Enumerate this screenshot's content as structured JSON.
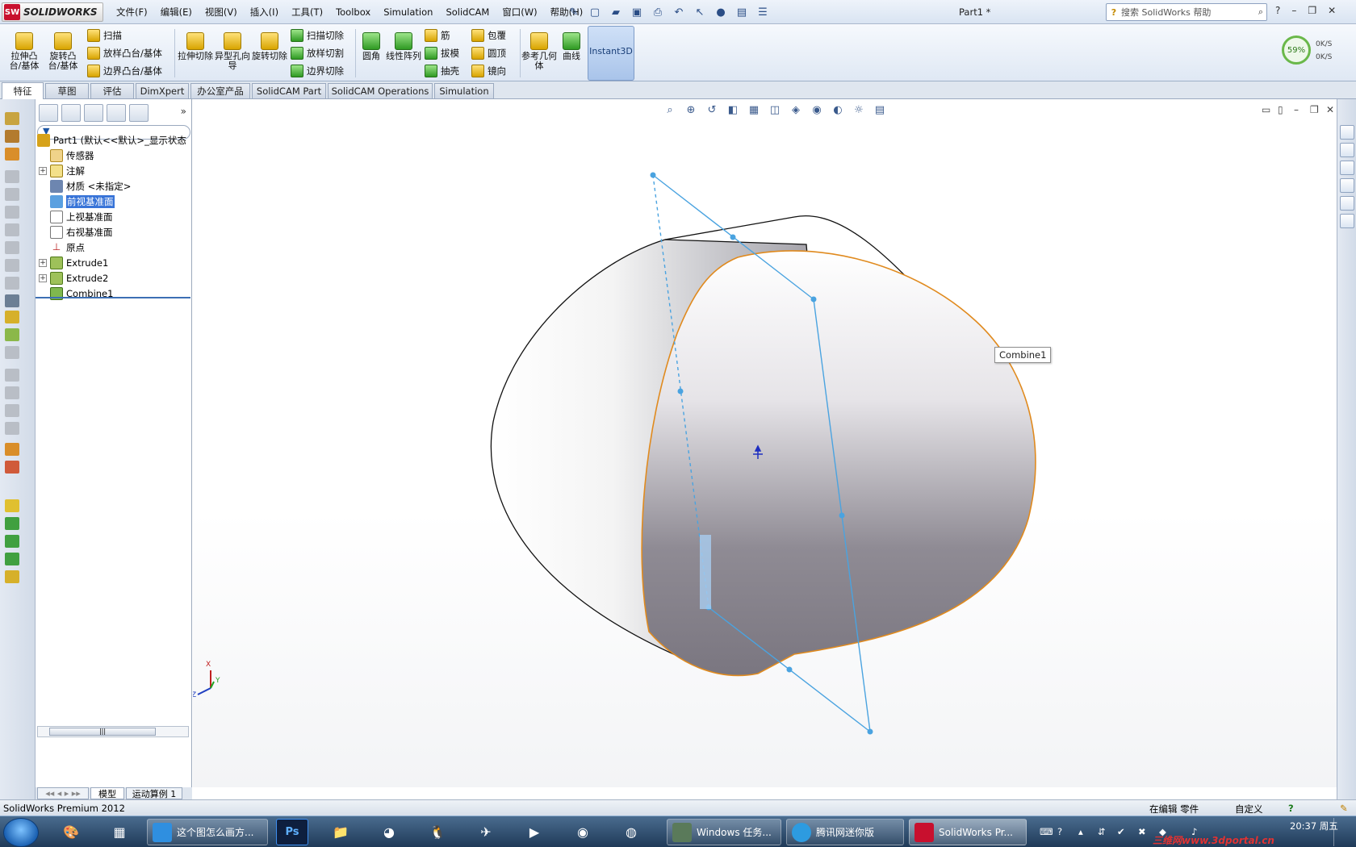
{
  "app": {
    "brand": "SOLIDWORKS",
    "doc_title": "Part1 *",
    "search_placeholder": "搜索 SolidWorks 帮助"
  },
  "menus": [
    "文件(F)",
    "编辑(E)",
    "视图(V)",
    "插入(I)",
    "工具(T)",
    "Toolbox",
    "Simulation",
    "SolidCAM",
    "窗口(W)",
    "帮助(H)"
  ],
  "commands": {
    "extrude_boss": "拉伸凸台/基体",
    "revolve_boss": "旋转凸台/基体",
    "sweep": "扫描",
    "loft_boss": "放样凸台/基体",
    "boundary_boss": "边界凸台/基体",
    "extrude_cut": "拉伸切除",
    "hole_wizard": "异型孔向导",
    "revolve_cut": "旋转切除",
    "sweep_cut": "扫描切除",
    "loft_cut": "放样切割",
    "boundary_cut": "边界切除",
    "fillet": "圆角",
    "linear_pattern": "线性阵列",
    "rib": "筋",
    "draft": "拔模",
    "shell": "抽壳",
    "wrap": "包覆",
    "dome": "圆顶",
    "mirror": "镜向",
    "ref_geometry": "参考几何体",
    "curves": "曲线",
    "instant3d": "Instant3D"
  },
  "performance": {
    "percent": "59%",
    "rate_up": "0K/S",
    "rate_down": "0K/S"
  },
  "tabs": [
    "特征",
    "草图",
    "评估",
    "DimXpert",
    "办公室产品",
    "SolidCAM Part",
    "SolidCAM Operations",
    "Simulation"
  ],
  "tree": {
    "root": "Part1  (默认<<默认>_显示状态",
    "items": [
      "传感器",
      "注解",
      "材质 <未指定>",
      "前视基准面",
      "上视基准面",
      "右视基准面",
      "原点",
      "Extrude1",
      "Extrude2",
      "Combine1"
    ]
  },
  "bottom_tabs": [
    "模型",
    "运动算例 1"
  ],
  "viewport": {
    "tooltip": "Combine1",
    "triad_x": "X",
    "triad_y": "Y",
    "triad_z": "Z"
  },
  "status": {
    "product": "SolidWorks Premium 2012",
    "mode": "在编辑 零件",
    "units": "自定义"
  },
  "taskbar": {
    "tasks": [
      "这个图怎么画方...",
      "Windows 任务...",
      "腾讯网迷你版",
      "SolidWorks Pr..."
    ],
    "time": "20:37 周五"
  },
  "watermark": "三维网www.3dportal.cn",
  "colors": {
    "selection_edge": "#e08a1e",
    "plane": "#4aa3e0",
    "brand_red": "#c8102e"
  }
}
